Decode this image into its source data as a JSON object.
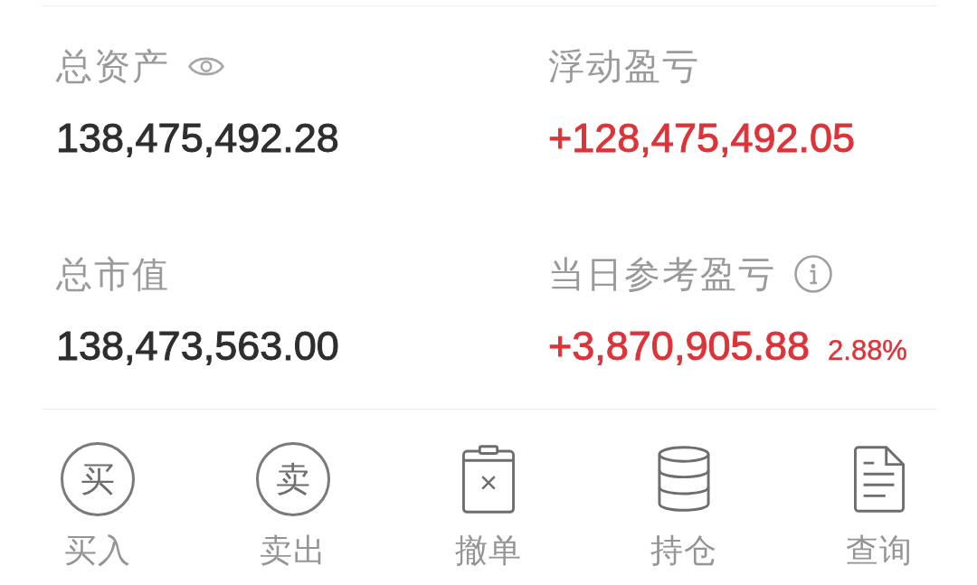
{
  "summary": [
    {
      "kind": "visibility-toggle",
      "label": "总资产",
      "value": "138,475,492.28",
      "color": "#2e2e2e"
    },
    {
      "kind": "plain",
      "label": "浮动盈亏",
      "value": "+128,475,492.05",
      "color": "#dc3439"
    },
    {
      "kind": "plain",
      "label": "总市值",
      "value": "138,473,563.00",
      "color": "#2e2e2e"
    },
    {
      "kind": "hint",
      "label": "当日参考盈亏",
      "value": "+3,870,905.88",
      "percent": "2.88%",
      "color": "#dc3439"
    }
  ],
  "actions": [
    {
      "label": "买入",
      "kind": "glyph",
      "glyph": "买"
    },
    {
      "label": "卖出",
      "kind": "glyph",
      "glyph": "卖"
    },
    {
      "label": "撤单",
      "kind": "clipboard"
    },
    {
      "label": "持仓",
      "kind": "stack"
    },
    {
      "label": "查询",
      "kind": "document"
    }
  ]
}
